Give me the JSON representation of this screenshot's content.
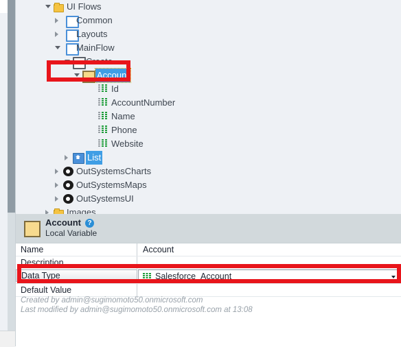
{
  "tree": {
    "name": "solution-tree",
    "items": [
      {
        "label": "UI Flows",
        "icon": "folder-icon",
        "indent": 55,
        "expander": "open",
        "selected": false
      },
      {
        "label": "Common",
        "icon": "flow-icon",
        "indent": 69,
        "expander": "closed",
        "selected": false
      },
      {
        "label": "Layouts",
        "icon": "flow-icon",
        "indent": 69,
        "expander": "closed",
        "selected": false
      },
      {
        "label": "MainFlow",
        "icon": "flow-icon",
        "indent": 69,
        "expander": "open",
        "selected": false
      },
      {
        "label": "Create",
        "icon": "screen-icon",
        "indent": 83,
        "expander": "open",
        "selected": false
      },
      {
        "label": "Account",
        "icon": "local-variable-icon",
        "indent": 97,
        "expander": "open",
        "selected": true
      },
      {
        "label": "Id",
        "icon": "entity-attribute-icon",
        "indent": 120,
        "expander": "none",
        "selected": false
      },
      {
        "label": "AccountNumber",
        "icon": "entity-attribute-icon",
        "indent": 120,
        "expander": "none",
        "selected": false
      },
      {
        "label": "Name",
        "icon": "entity-attribute-icon",
        "indent": 120,
        "expander": "none",
        "selected": false
      },
      {
        "label": "Phone",
        "icon": "entity-attribute-icon",
        "indent": 120,
        "expander": "none",
        "selected": false
      },
      {
        "label": "Website",
        "icon": "entity-attribute-icon",
        "indent": 120,
        "expander": "none",
        "selected": false
      },
      {
        "label": "List",
        "icon": "widget-icon",
        "indent": 83,
        "expander": "closed",
        "selected": true
      },
      {
        "label": "OutSystemsCharts",
        "icon": "module-icon",
        "indent": 69,
        "expander": "closed",
        "selected": false
      },
      {
        "label": "OutSystemsMaps",
        "icon": "module-icon",
        "indent": 69,
        "expander": "closed",
        "selected": false
      },
      {
        "label": "OutSystemsUI",
        "icon": "module-icon",
        "indent": 69,
        "expander": "closed",
        "selected": false
      },
      {
        "label": "Images",
        "icon": "folder-icon",
        "indent": 55,
        "expander": "closed",
        "selected": false
      }
    ]
  },
  "properties": {
    "header": {
      "title": "Account",
      "subtitle": "Local Variable",
      "help_glyph": "?"
    },
    "rows": [
      {
        "name": "Name",
        "value": "Account",
        "active": false,
        "value_icon": null
      },
      {
        "name": "Description",
        "value": "",
        "active": false,
        "value_icon": null
      },
      {
        "name": "Data Type",
        "value": "Salesforce_Account",
        "active": true,
        "value_icon": "entity-grid-icon"
      },
      {
        "name": "Default Value",
        "value": "",
        "active": false,
        "value_icon": null
      }
    ],
    "meta": {
      "created": "Created by admin@sugimomoto50.onmicrosoft.com",
      "modified": "Last modified by admin@sugimomoto50.onmicrosoft.com at  13:08"
    }
  },
  "annotations": {
    "account_highlight": "red-rectangle-around-account-node",
    "datatype_highlight": "red-rectangle-around-data-type-row"
  },
  "colors": {
    "tree_background": "#eef1f5",
    "selection_blue": "#3f9ee5",
    "panel_header": "#d2d9dc",
    "annotation_red": "#e8151b",
    "entity_green": "#1f9d3a",
    "folder_yellow": "#f5c342"
  }
}
